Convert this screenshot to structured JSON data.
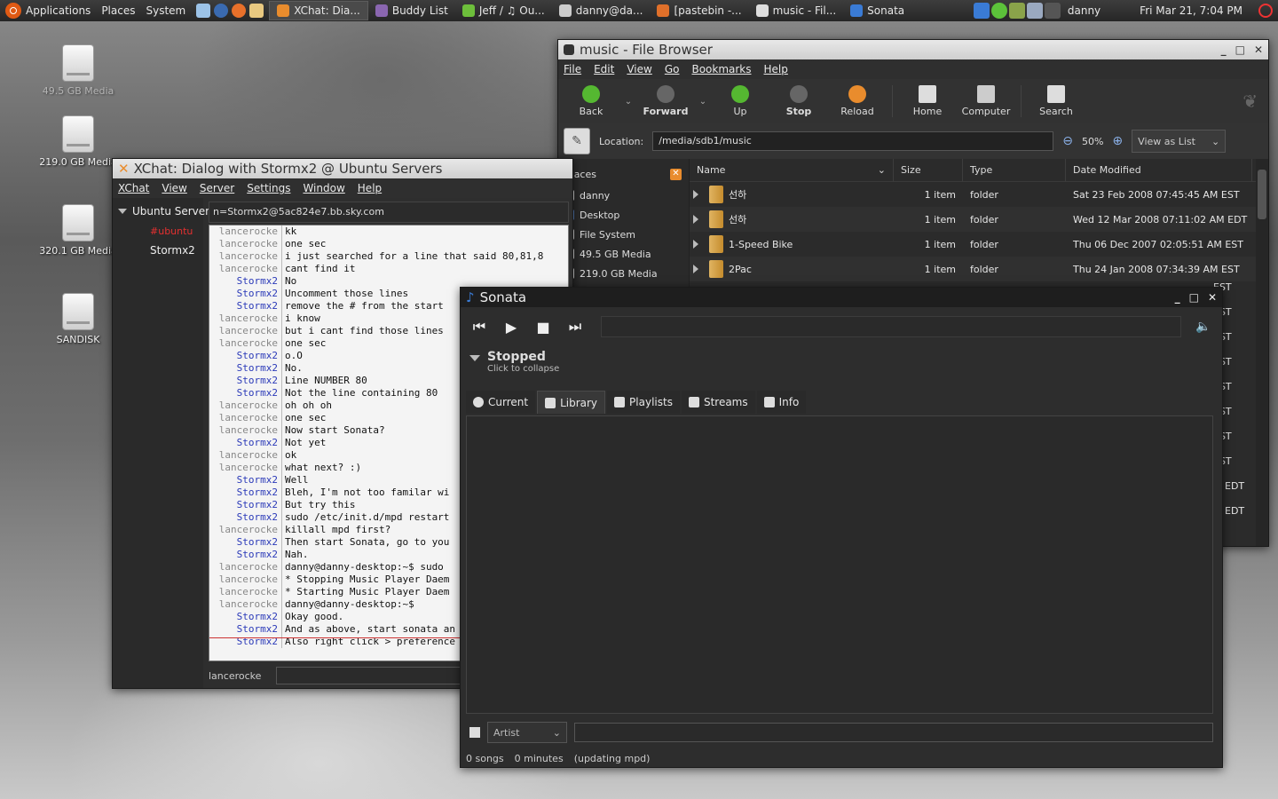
{
  "panel": {
    "applications": "Applications",
    "places": "Places",
    "system": "System",
    "tasks": [
      {
        "label": "XChat: Dia...",
        "active": true,
        "color": "#e98c2d"
      },
      {
        "label": "Buddy List",
        "active": false,
        "color": "#8a66b0"
      },
      {
        "label": "Jeff / ♫ Ou...",
        "active": false,
        "color": "#6dbf3b"
      },
      {
        "label": "danny@da...",
        "active": false,
        "color": "#cccccc"
      },
      {
        "label": "[pastebin -...",
        "active": false,
        "color": "#e0702a"
      },
      {
        "label": "music - Fil...",
        "active": false,
        "color": "#dddddd"
      },
      {
        "label": "Sonata",
        "active": false,
        "color": "#3a7bd5"
      }
    ],
    "user": "danny",
    "clock": "Fri Mar 21,  7:04 PM"
  },
  "desktop": {
    "icons": [
      {
        "label": "49.5 GB Media"
      },
      {
        "label": "219.0 GB Media"
      },
      {
        "label": "320.1 GB Media"
      },
      {
        "label": "SANDISK"
      }
    ]
  },
  "nautilus": {
    "title": "music - File Browser",
    "menu": [
      "File",
      "Edit",
      "View",
      "Go",
      "Bookmarks",
      "Help"
    ],
    "toolbar": {
      "back": "Back",
      "forward": "Forward",
      "up": "Up",
      "stop": "Stop",
      "reload": "Reload",
      "home": "Home",
      "computer": "Computer",
      "search": "Search"
    },
    "location_label": "Location:",
    "location_value": "/media/sdb1/music",
    "zoom": "50%",
    "view_mode": "View as List",
    "places_header": "Places",
    "places": [
      "danny",
      "Desktop",
      "File System",
      "49.5 GB Media",
      "219.0 GB Media"
    ],
    "columns": {
      "name": "Name",
      "size": "Size",
      "type": "Type",
      "date": "Date Modified"
    },
    "rows": [
      {
        "name": "선하",
        "size": "1 item",
        "type": "folder",
        "date": "Sat 23 Feb 2008 07:45:45 AM EST"
      },
      {
        "name": "선하",
        "size": "1 item",
        "type": "folder",
        "date": "Wed 12 Mar 2008 07:11:02 AM EDT"
      },
      {
        "name": "1-Speed Bike",
        "size": "1 item",
        "type": "folder",
        "date": "Thu 06 Dec 2007 02:05:51 AM EST"
      },
      {
        "name": "2Pac",
        "size": "1 item",
        "type": "folder",
        "date": "Thu 24 Jan 2008 07:34:39 AM EST"
      }
    ],
    "hidden_date_tails": [
      "EST",
      "EST",
      "EST",
      "EST",
      "EST",
      "EST",
      "EST",
      "EST",
      "M EDT",
      "M EDT"
    ]
  },
  "xchat": {
    "title": "XChat: Dialog with Stormx2 @ Ubuntu Servers",
    "menu": [
      "XChat",
      "View",
      "Server",
      "Settings",
      "Window",
      "Help"
    ],
    "server": "Ubuntu Servers",
    "channel": "#ubuntu",
    "query": "Stormx2",
    "topic": "n=Stormx2@5ac824e7.bb.sky.com",
    "lines": [
      {
        "nick": "lancerocke",
        "msg": "kk"
      },
      {
        "nick": "lancerocke",
        "msg": "one sec"
      },
      {
        "nick": "lancerocke",
        "msg": "i just searched for a line that said 80,81,8"
      },
      {
        "nick": "lancerocke",
        "msg": "cant find it"
      },
      {
        "nick": "Stormx2",
        "msg": "No"
      },
      {
        "nick": "Stormx2",
        "msg": "Uncomment those lines"
      },
      {
        "nick": "Stormx2",
        "msg": "remove the # from the start"
      },
      {
        "nick": "lancerocke",
        "msg": "i know"
      },
      {
        "nick": "lancerocke",
        "msg": "but i cant find those lines"
      },
      {
        "nick": "lancerocke",
        "msg": "one sec"
      },
      {
        "nick": "Stormx2",
        "msg": "o.O"
      },
      {
        "nick": "Stormx2",
        "msg": "No."
      },
      {
        "nick": "Stormx2",
        "msg": "Line NUMBER 80"
      },
      {
        "nick": "Stormx2",
        "msg": "Not the line containing 80"
      },
      {
        "nick": "lancerocke",
        "msg": "oh oh oh"
      },
      {
        "nick": "lancerocke",
        "msg": "one sec"
      },
      {
        "nick": "lancerocke",
        "msg": "Now start Sonata?"
      },
      {
        "nick": "Stormx2",
        "msg": "Not yet"
      },
      {
        "nick": "lancerocke",
        "msg": "ok"
      },
      {
        "nick": "lancerocke",
        "msg": "what next? :)"
      },
      {
        "nick": "Stormx2",
        "msg": "Well"
      },
      {
        "nick": "Stormx2",
        "msg": "Bleh, I'm not too familar wi"
      },
      {
        "nick": "Stormx2",
        "msg": "But try this"
      },
      {
        "nick": "Stormx2",
        "msg": "sudo /etc/init.d/mpd restart"
      },
      {
        "nick": "lancerocke",
        "msg": "killall mpd first?"
      },
      {
        "nick": "Stormx2",
        "msg": "Then start Sonata, go to you"
      },
      {
        "nick": "Stormx2",
        "msg": "Nah."
      },
      {
        "nick": "lancerocke",
        "msg": "danny@danny-desktop:~$ sudo"
      },
      {
        "nick": "lancerocke",
        "msg": " * Stopping Music Player Daem"
      },
      {
        "nick": "lancerocke",
        "msg": " * Starting Music Player Daem"
      },
      {
        "nick": "lancerocke",
        "msg": "danny@danny-desktop:~$"
      },
      {
        "nick": "Stormx2",
        "msg": "Okay good."
      },
      {
        "nick": "Stormx2",
        "msg": "And as above, start sonata an"
      },
      {
        "nick": "Stormx2",
        "msg": "Also right click > preference"
      }
    ],
    "input_nick": "lancerocke"
  },
  "sonata": {
    "title": "Sonata",
    "state": "Stopped",
    "state_hint": "Click to collapse",
    "tabs": [
      {
        "label": "Current",
        "active": false
      },
      {
        "label": "Library",
        "active": true
      },
      {
        "label": "Playlists",
        "active": false
      },
      {
        "label": "Streams",
        "active": false
      },
      {
        "label": "Info",
        "active": false
      }
    ],
    "filter_type": "Artist",
    "status": {
      "songs": "0 songs",
      "minutes": "0 minutes",
      "note": "(updating mpd)"
    }
  }
}
